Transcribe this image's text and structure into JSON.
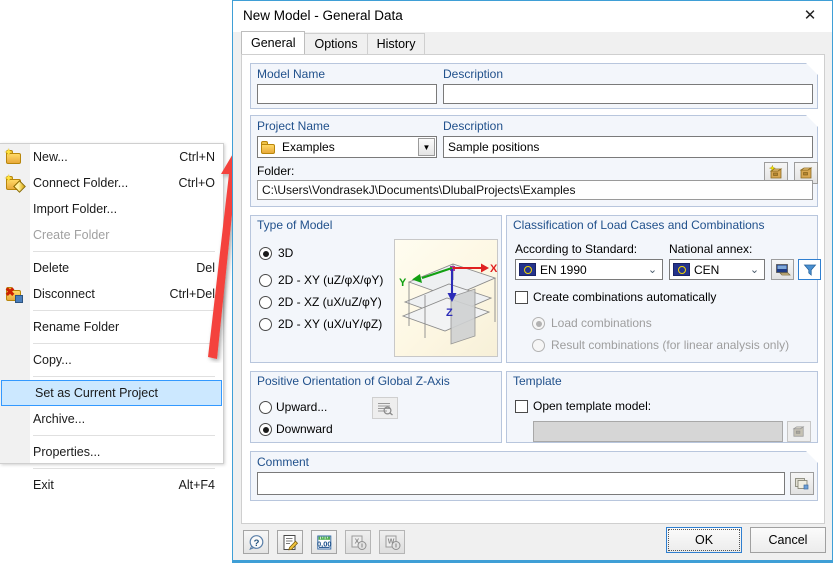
{
  "context_menu": {
    "items": [
      {
        "label": "New...",
        "accel": "Ctrl+N",
        "icon": "new-folder-icon",
        "state": "normal"
      },
      {
        "label": "Connect Folder...",
        "accel": "Ctrl+O",
        "icon": "connect-folder-icon",
        "state": "normal"
      },
      {
        "label": "Import Folder...",
        "accel": "",
        "icon": "",
        "state": "normal"
      },
      {
        "label": "Create Folder",
        "accel": "",
        "icon": "",
        "state": "disabled"
      },
      {
        "label": "Delete",
        "accel": "Del",
        "icon": "",
        "state": "normal"
      },
      {
        "label": "Disconnect",
        "accel": "Ctrl+Del",
        "icon": "disconnect-folder-icon",
        "state": "normal"
      },
      {
        "label": "Rename Folder",
        "accel": "",
        "icon": "",
        "state": "normal"
      },
      {
        "label": "Copy...",
        "accel": "",
        "icon": "",
        "state": "normal"
      },
      {
        "label": "Set as Current Project",
        "accel": "",
        "icon": "",
        "state": "selected"
      },
      {
        "label": "Archive...",
        "accel": "",
        "icon": "",
        "state": "normal"
      },
      {
        "label": "Properties...",
        "accel": "",
        "icon": "",
        "state": "normal"
      },
      {
        "label": "Exit",
        "accel": "Alt+F4",
        "icon": "",
        "state": "normal"
      }
    ]
  },
  "dialog": {
    "title": "New Model - General Data",
    "close_glyph": "✕",
    "tabs": [
      {
        "label": "General",
        "active": true
      },
      {
        "label": "Options",
        "active": false
      },
      {
        "label": "History",
        "active": false
      }
    ],
    "model_name": {
      "label": "Model Name",
      "value": "",
      "placeholder": ""
    },
    "model_description": {
      "label": "Description",
      "value": "",
      "placeholder": ""
    },
    "project_name": {
      "label": "Project Name",
      "value": "Examples"
    },
    "project_description": {
      "label": "Description",
      "value": "Sample positions"
    },
    "folder": {
      "label": "Folder:",
      "value": "C:\\Users\\VondrasekJ\\Documents\\DlubalProjects\\Examples"
    },
    "project_buttons": [
      {
        "name": "new-project-button",
        "icon": "new-archive-box-icon"
      },
      {
        "name": "open-project-button",
        "icon": "archive-box-icon"
      }
    ],
    "type_of_model": {
      "title": "Type of Model",
      "options": [
        {
          "label": "3D",
          "checked": true
        },
        {
          "label": "2D - XY (uZ/φX/φY)",
          "checked": false
        },
        {
          "label": "2D - XZ (uX/uZ/φY)",
          "checked": false
        },
        {
          "label": "2D - XY (uX/uY/φZ)",
          "checked": false
        }
      ],
      "preview_axes": [
        "X",
        "Y",
        "Z"
      ]
    },
    "classification": {
      "title": "Classification of Load Cases and Combinations",
      "standard_label": "According to Standard:",
      "standard_value": "EN 1990",
      "annex_label": "National annex:",
      "annex_value": "CEN",
      "annex_edit_button": "edit-annex-icon",
      "annex_filter_button": "filter-icon",
      "auto_combinations": {
        "label": "Create combinations automatically",
        "checked": false
      },
      "sub_options": [
        {
          "label": "Load combinations",
          "checked": true,
          "disabled": true
        },
        {
          "label": "Result combinations (for linear analysis only)",
          "checked": false,
          "disabled": true
        }
      ]
    },
    "z_axis": {
      "title": "Positive Orientation of Global Z-Axis",
      "options": [
        {
          "label": "Upward...",
          "checked": false
        },
        {
          "label": "Downward",
          "checked": true
        }
      ],
      "preview_button": "zoom-preview-icon"
    },
    "template": {
      "title": "Template",
      "checkbox_label": "Open template model:",
      "checkbox_checked": false,
      "value": "",
      "browse_button": "archive-box-icon"
    },
    "comment": {
      "label": "Comment",
      "value": "",
      "browse_button": "copy-comment-icon"
    },
    "footer_buttons": [
      {
        "name": "help-button",
        "icon": "question-mark-icon",
        "disabled": false
      },
      {
        "name": "notes-button",
        "icon": "edit-note-icon",
        "disabled": false
      },
      {
        "name": "units-button",
        "icon": "units-decimals-icon",
        "disabled": false
      },
      {
        "name": "import-button",
        "icon": "import-excel-icon",
        "disabled": true
      },
      {
        "name": "export-button",
        "icon": "export-word-icon",
        "disabled": true
      }
    ],
    "ok_label": "OK",
    "cancel_label": "Cancel"
  },
  "colors": {
    "accent": "#3f9fd6",
    "group_label": "#21518c",
    "selection": "#cce8ff",
    "selection_border": "#3399ff",
    "arrow": "#f4433c"
  }
}
